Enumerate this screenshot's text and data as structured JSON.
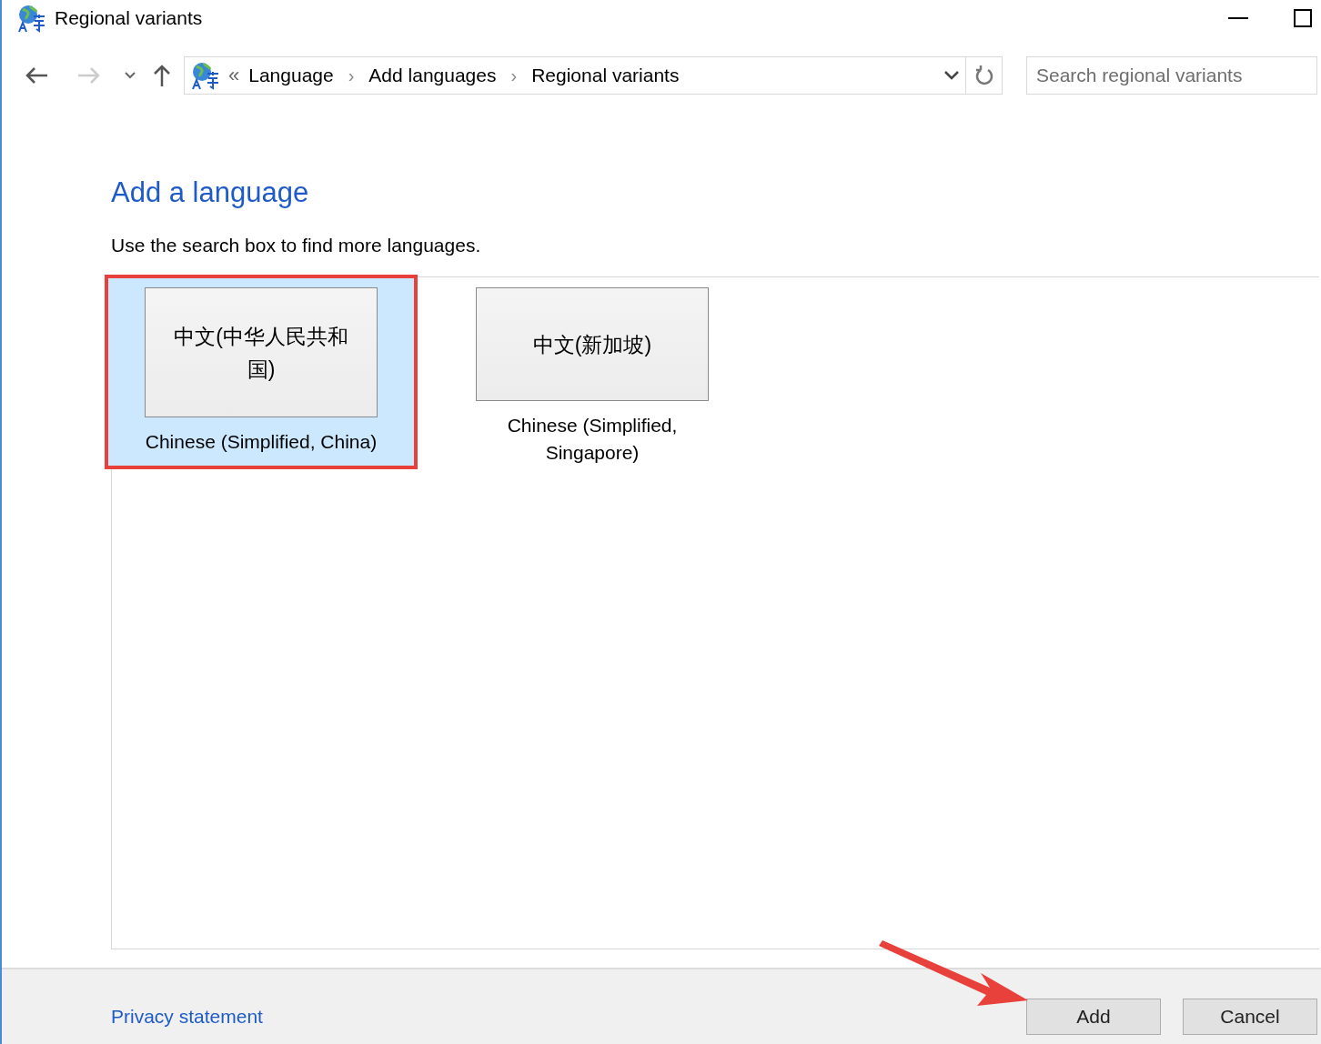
{
  "window": {
    "title": "Regional variants"
  },
  "nav": {
    "breadcrumb_prefix": "«",
    "breadcrumbs": [
      "Language",
      "Add languages",
      "Regional variants"
    ],
    "separator": "›",
    "search": {
      "placeholder": "Search regional variants"
    }
  },
  "heading": "Add a language",
  "hint": "Use the search box to find more languages.",
  "tiles": [
    {
      "native": "中文(中华人民共和国)",
      "label": "Chinese (Simplified, China)",
      "selected": true,
      "highlighted": true
    },
    {
      "native": "中文(新加坡)",
      "label": "Chinese (Simplified, Singapore)",
      "selected": false,
      "highlighted": false
    }
  ],
  "footer": {
    "link": "Privacy statement",
    "buttons": [
      {
        "label": "Add",
        "pointed_at": true
      },
      {
        "label": "Cancel",
        "pointed_at": false
      }
    ]
  }
}
